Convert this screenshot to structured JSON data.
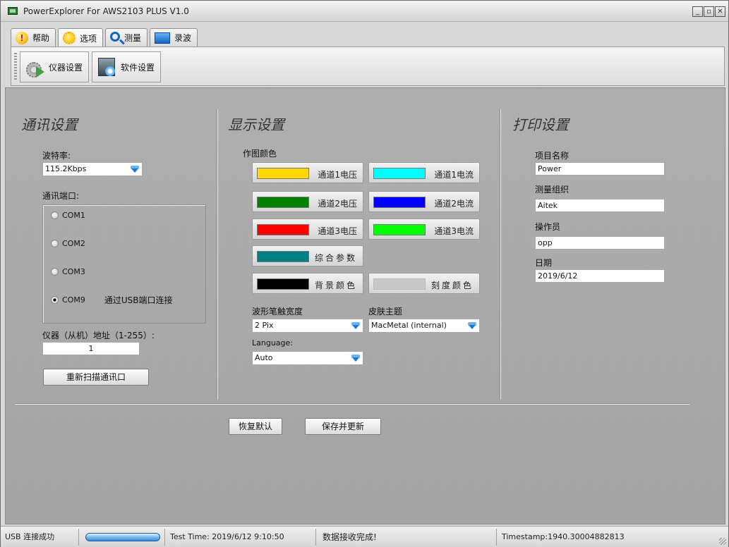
{
  "window": {
    "title": "PowerExplorer For AWS2103 PLUS V1.0"
  },
  "tabs": [
    {
      "label": "帮助",
      "icon": "help-icon"
    },
    {
      "label": "选项",
      "icon": "options-icon"
    },
    {
      "label": "测量",
      "icon": "measure-icon"
    },
    {
      "label": "录波",
      "icon": "record-icon"
    }
  ],
  "active_tab": "选项",
  "toolbar": {
    "instrument_settings": "仪器设置",
    "software_settings": "软件设置"
  },
  "comm": {
    "title": "通讯设置",
    "baud_label": "波特率:",
    "baud_value": "115.2Kbps",
    "port_label": "通讯端口:",
    "ports": [
      "COM1",
      "COM2",
      "COM3",
      "COM9"
    ],
    "selected_port": "COM9",
    "usb_note": "通过USB端口连接",
    "address_label": "仪器（从机）地址（1-255）:",
    "address_value": "1",
    "rescan_button": "重新扫描通讯口"
  },
  "display": {
    "title": "显示设置",
    "plot_color_label": "作图颜色",
    "colors": [
      {
        "label": "通道1电压",
        "color": "#FFD700"
      },
      {
        "label": "通道1电流",
        "color": "#00FFFF"
      },
      {
        "label": "通道2电压",
        "color": "#008000"
      },
      {
        "label": "通道2电流",
        "color": "#0000FF"
      },
      {
        "label": "通道3电压",
        "color": "#FF0000"
      },
      {
        "label": "通道3电流",
        "color": "#00FF00"
      },
      {
        "label": "综合参数",
        "color": "#008080"
      },
      {
        "label": "背景颜色",
        "color": "#000000"
      },
      {
        "label": "刻度颜色",
        "color": "#C8C8C8"
      }
    ],
    "pen_width_label": "波形笔触宽度",
    "pen_width_value": "2 Pix",
    "skin_label": "皮肤主题",
    "skin_value": "MacMetal (internal)",
    "language_label": "Language:",
    "language_value": "Auto"
  },
  "print": {
    "title": "打印设置",
    "project_label": "项目名称",
    "project_value": "Power",
    "org_label": "测量组织",
    "org_value": "Aitek",
    "operator_label": "操作员",
    "operator_value": "opp",
    "date_label": "日期",
    "date_value": "2019/6/12"
  },
  "actions": {
    "restore_default": "恢复默认",
    "save_update": "保存并更新"
  },
  "status": {
    "usb": "USB 连接成功",
    "test_time": "Test Time: 2019/6/12 9:10:50",
    "data_status": "数据接收完成!",
    "timestamp": "Timestamp:1940.30004882813"
  }
}
